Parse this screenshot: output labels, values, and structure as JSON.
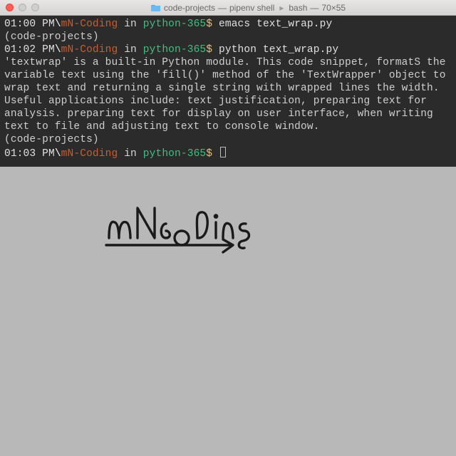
{
  "window": {
    "title_folder": "code-projects",
    "title_proc": "pipenv shell",
    "title_shell": "bash",
    "title_size": "70×55"
  },
  "prompts": [
    {
      "time": "01:00 PM",
      "user": "mN-Coding",
      "in": "in",
      "env": "python-365",
      "dollar": "$",
      "cmd": "emacs text_wrap.py"
    },
    {
      "time": "01:02 PM",
      "user": "mN-Coding",
      "in": "in",
      "env": "python-365",
      "dollar": "$",
      "cmd": "python text_wrap.py"
    },
    {
      "time": "01:03 PM",
      "user": "mN-Coding",
      "in": "in",
      "env": "python-365",
      "dollar": "$",
      "cmd": ""
    }
  ],
  "venv_line": "(code-projects)",
  "output": "'textwrap' is a built-in Python module. This code snippet, formatS the variable text using the 'fill()' method of the 'TextWrapper' object to wrap text and returning a single string with wrapped lines the width. Useful applications include: text justification, preparing text for analysis. preparing text for display on user interface, when writing text to file and adjusting text to console window.",
  "brand": "mNcoding"
}
